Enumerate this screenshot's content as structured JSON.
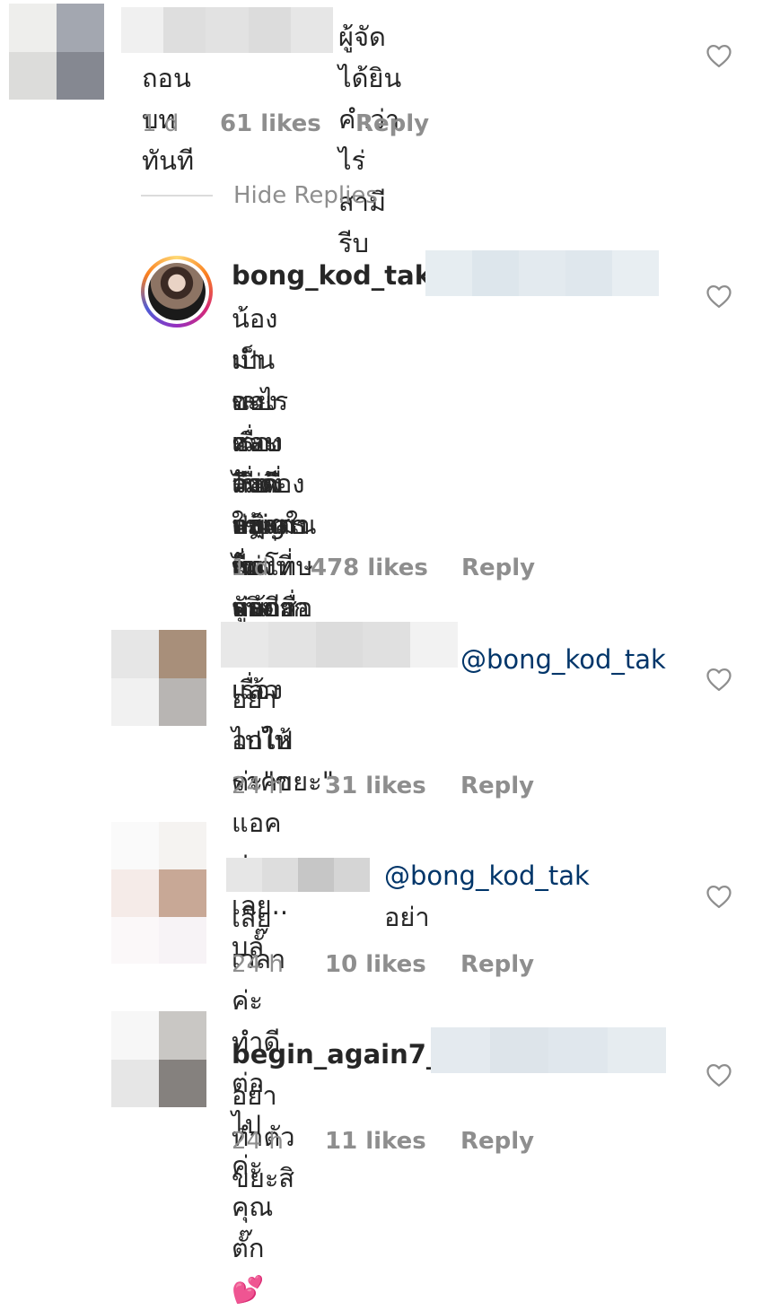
{
  "comments": [
    {
      "username": "",
      "mention": "",
      "text_line1": "ผู้จัดได้ยินคำว่าไร่สามี รีบ",
      "text_rest": [
        "ถอนบททันที"
      ],
      "time": "1 d",
      "likes": "61 likes",
      "reply": "Reply",
      "avatar_colors": [
        "#eeeeec",
        "#a3a7b0",
        "#dcdcda",
        "#858891"
      ],
      "blur_colors": [
        "#f0f0f0",
        "#dedede",
        "#e2e2e2",
        "#dcdcdc",
        "#e6e6e6"
      ]
    },
    {
      "username": "bong_kod_tak",
      "mention": "",
      "text_line1": "น้องเป็นอะไร ชอบว่าคนอื่นค่ะ อย่า",
      "text_rest": [
        "มำเลยค่ะ ไม่ดี และไม่จริงด้วย เรื่อง",
        "ของเรื่องคือพี่ ปฏิเสธเขาหลายเรื่อง",
        "และเรื่องล่าสุดก็รับปากเค้าไว้แล้ว",
        "จึงต้องออกมาขอโทษหน้าสื่อ น้อง",
        "ใช้igในทางที่ถูกดีกว่าค่ะ"
      ],
      "time": "1 d",
      "likes": "478 likes",
      "reply": "Reply",
      "blur_colors": [
        "#e6edf1",
        "#dde6ec",
        "#e3eaef",
        "#dfe7ed",
        "#e8eef2"
      ]
    },
    {
      "username": "",
      "mention": "@bong_kod_tak",
      "text_line1": "",
      "text_rest": [
        "อย่าไปให้ราคาแอคปลอมเลย.. บลั๊",
        "อกไปค่ะ\"ขยะ\""
      ],
      "time": "24 h",
      "likes": "31 likes",
      "reply": "Reply",
      "avatar_colors": [
        "#e6e6e6",
        "#a88f7a",
        "#f1f1f1",
        "#b8b5b3"
      ],
      "blur_colors": [
        "#e8e8e8",
        "#e3e3e3",
        "#dcdcdc",
        "#e0e0e0",
        "#f2f2f2"
      ]
    },
    {
      "username": "",
      "mention": "@bong_kod_tak",
      "text_after": " อย่า",
      "text_rest": [
        "เสียเวลาค่ะ ทำดีต่อไปค่ะคุณตั๊ก💕"
      ],
      "time": "24 h",
      "likes": "10 likes",
      "reply": "Reply",
      "avatar_colors": [
        "#fafafa",
        "#f5f3f1",
        "#f5ebe8",
        "#c8a896",
        "#fbf8f9",
        "#f7f3f6"
      ],
      "blur_colors": [
        "#e6e6e6",
        "#dddddd",
        "#c6c6c6",
        "#d5d5d5"
      ]
    },
    {
      "username": "begin_again7_",
      "mention": "",
      "text_line1": "",
      "text_rest": [
        "อย่าทำตัวขยะสิ"
      ],
      "time": "24 h",
      "likes": "11 likes",
      "reply": "Reply",
      "avatar_colors": [
        "#f7f7f7",
        "#c9c7c4",
        "#e6e6e6",
        "#85817e"
      ],
      "blur_colors": [
        "#e4eaef",
        "#dde4ea",
        "#e0e7ed",
        "#e6ecf0"
      ]
    }
  ],
  "hide_replies": "Hide Replies",
  "icons": {
    "like": "heart-outline-icon"
  },
  "colors": {
    "text": "#262626",
    "meta": "#8e8e8e",
    "mention": "#003569",
    "divider": "#dbdbdb"
  }
}
